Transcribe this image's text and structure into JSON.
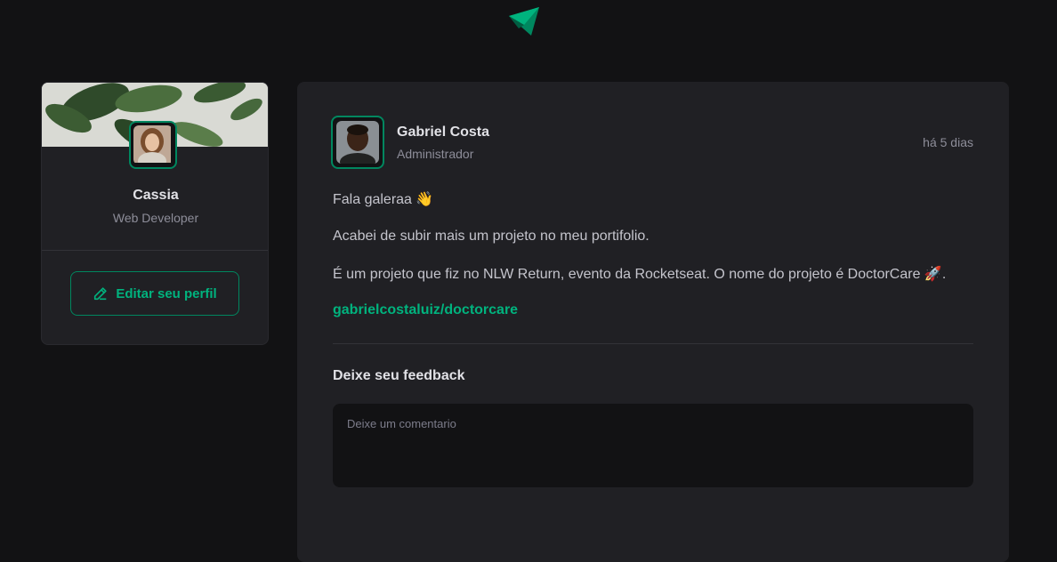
{
  "header": {
    "logo_icon": "ignite-feed-logo-icon"
  },
  "sidebar": {
    "name": "Cassia",
    "role": "Web Developer",
    "edit_button_label": "Editar seu perfil",
    "edit_icon": "pencil-line-icon"
  },
  "post": {
    "author": {
      "name": "Gabriel Costa",
      "role": "Administrador"
    },
    "time": "há 5 dias",
    "content": [
      "Fala galeraa 👋",
      "Acabei de subir mais um projeto no meu portifolio.",
      "É um projeto que fiz no NLW Return, evento da Rocketseat. O nome do projeto é DoctorCare 🚀."
    ],
    "link": "gabrielcostaluiz/doctorcare",
    "feedback_title": "Deixe seu feedback",
    "comment_placeholder": "Deixe um comentario"
  },
  "colors": {
    "accent": "#00b37e",
    "accent_dark": "#00875f",
    "background": "#121214",
    "card": "#202024"
  }
}
